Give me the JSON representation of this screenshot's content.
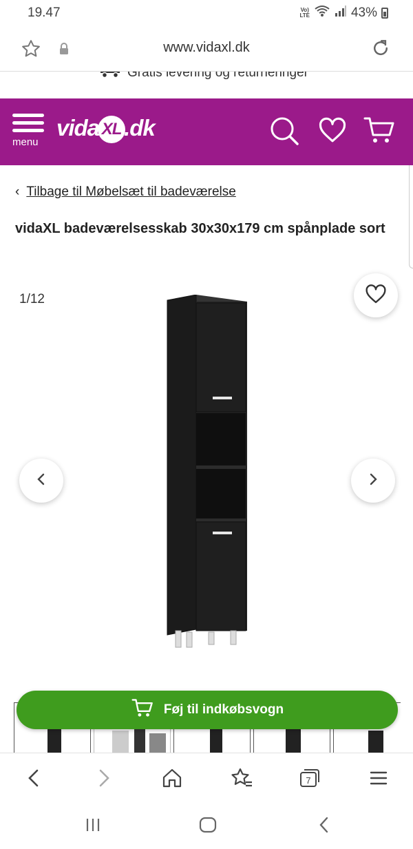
{
  "status_bar": {
    "time": "19.47",
    "network": "VoLTE",
    "lte_top": "Vo)",
    "lte_bottom": "LTE",
    "battery": "43%"
  },
  "url_bar": {
    "url": "www.vidaxl.dk"
  },
  "promo": {
    "text": "Gratis levering og returneringer"
  },
  "header": {
    "menu_label": "menu",
    "logo_prefix": "vida",
    "logo_xl": "XL",
    "logo_suffix": ".dk",
    "brand_color": "#9b1a8a"
  },
  "breadcrumb": {
    "chevron": "‹",
    "text": "Tilbage til Møbelsæt til badeværelse"
  },
  "product": {
    "title": "vidaXL badeværelsesskab 30x30x179 cm spånplade sort",
    "gallery_counter": "1/12"
  },
  "cart": {
    "button_label": "Føj til indkøbsvogn",
    "accent_color": "#3f9c1e"
  },
  "browser_bar": {
    "tab_count": "7"
  },
  "icons": [
    "star-icon",
    "lock-icon",
    "reload-icon",
    "truck-icon",
    "hamburger-icon",
    "search-icon",
    "heart-icon",
    "cart-icon",
    "chevron-left-icon",
    "chevron-right-icon",
    "home-icon",
    "bookmark-star-icon",
    "tabs-icon",
    "more-menu-icon",
    "recents-icon",
    "home-circle-icon",
    "back-icon"
  ]
}
